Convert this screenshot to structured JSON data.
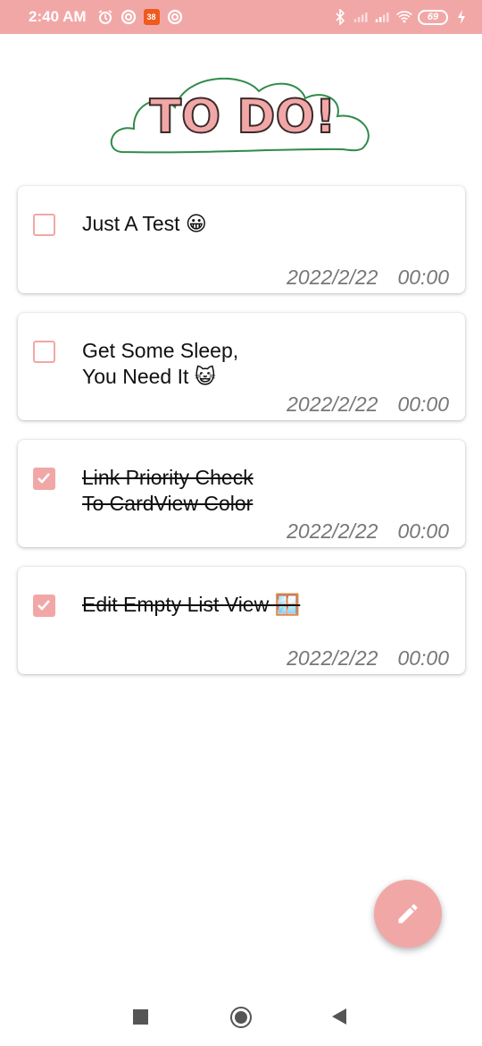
{
  "status_bar": {
    "time": "2:40 AM",
    "badge_text": "38",
    "battery": "69",
    "icons": [
      "alarm-icon",
      "app-icon",
      "app-badge-icon",
      "app-icon",
      "bluetooth-icon",
      "signal-icon",
      "signal-icon",
      "wifi-icon",
      "battery-icon",
      "charging-icon"
    ],
    "color": "#f2a7a7"
  },
  "header": {
    "logo_text": "TO DO!"
  },
  "tasks": [
    {
      "title": "Just A Test 😀",
      "checked": false,
      "date": "2022/2/22",
      "time": "00:00"
    },
    {
      "title": "Get Some Sleep,\nYou Need It 😺",
      "checked": false,
      "date": "2022/2/22",
      "time": "00:00"
    },
    {
      "title": "Link Priority Check\nTo CardView Color",
      "checked": true,
      "date": "2022/2/22",
      "time": "00:00"
    },
    {
      "title": "Edit Empty List View 🪟",
      "checked": true,
      "date": "2022/2/22",
      "time": "00:00"
    }
  ],
  "fab": {
    "icon": "pencil-icon"
  },
  "nav_bar": {
    "icons": [
      "recent-apps-icon",
      "home-icon",
      "back-icon"
    ]
  },
  "colors": {
    "accent": "#f2a7a7",
    "cloud_outline": "#2e8b4a",
    "logo_stroke": "#3a2a2a"
  }
}
